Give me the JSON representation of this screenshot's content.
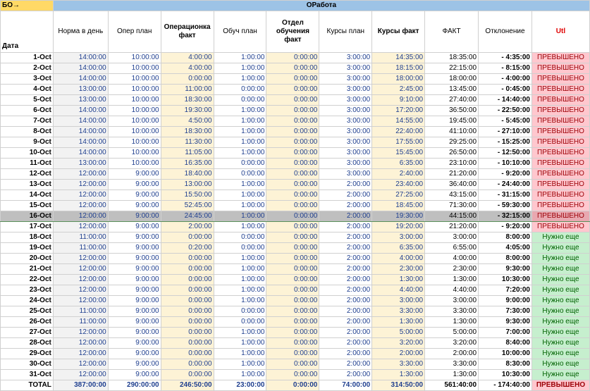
{
  "top": {
    "corner": "БО→",
    "group": "ОРабота"
  },
  "headers": {
    "date": "Дата",
    "norm": "Норма в день",
    "oper_plan": "Опер план",
    "oper_fact": "Операционка факт",
    "train_plan": "Обуч план",
    "train_dept_fact": "Отдел обучения факт",
    "course_plan": "Курсы план",
    "course_fact": "Курсы факт",
    "fact": "ФАКТ",
    "deviation": "Отклонение",
    "util": "Utl"
  },
  "rows": [
    {
      "date": "1-Oct",
      "norm": "14:00:00",
      "oper_plan": "10:00:00",
      "oper_fact": "4:00:00",
      "train_plan": "1:00:00",
      "dept": "0:00:00",
      "course_plan": "3:00:00",
      "course_fact": "14:35:00",
      "fact": "18:35:00",
      "dev": "- 4:35:00",
      "status": "ПРЕВЫШЕНО"
    },
    {
      "date": "2-Oct",
      "norm": "14:00:00",
      "oper_plan": "10:00:00",
      "oper_fact": "4:00:00",
      "train_plan": "1:00:00",
      "dept": "0:00:00",
      "course_plan": "3:00:00",
      "course_fact": "18:15:00",
      "fact": "22:15:00",
      "dev": "- 8:15:00",
      "status": "ПРЕВЫШЕНО"
    },
    {
      "date": "3-Oct",
      "norm": "14:00:00",
      "oper_plan": "10:00:00",
      "oper_fact": "0:00:00",
      "train_plan": "1:00:00",
      "dept": "0:00:00",
      "course_plan": "3:00:00",
      "course_fact": "18:00:00",
      "fact": "18:00:00",
      "dev": "- 4:00:00",
      "status": "ПРЕВЫШЕНО"
    },
    {
      "date": "4-Oct",
      "norm": "13:00:00",
      "oper_plan": "10:00:00",
      "oper_fact": "11:00:00",
      "train_plan": "0:00:00",
      "dept": "0:00:00",
      "course_plan": "3:00:00",
      "course_fact": "2:45:00",
      "fact": "13:45:00",
      "dev": "- 0:45:00",
      "status": "ПРЕВЫШЕНО"
    },
    {
      "date": "5-Oct",
      "norm": "13:00:00",
      "oper_plan": "10:00:00",
      "oper_fact": "18:30:00",
      "train_plan": "0:00:00",
      "dept": "0:00:00",
      "course_plan": "3:00:00",
      "course_fact": "9:10:00",
      "fact": "27:40:00",
      "dev": "- 14:40:00",
      "status": "ПРЕВЫШЕНО"
    },
    {
      "date": "6-Oct",
      "norm": "14:00:00",
      "oper_plan": "10:00:00",
      "oper_fact": "19:30:00",
      "train_plan": "1:00:00",
      "dept": "0:00:00",
      "course_plan": "3:00:00",
      "course_fact": "17:20:00",
      "fact": "36:50:00",
      "dev": "- 22:50:00",
      "status": "ПРЕВЫШЕНО"
    },
    {
      "date": "7-Oct",
      "norm": "14:00:00",
      "oper_plan": "10:00:00",
      "oper_fact": "4:50:00",
      "train_plan": "1:00:00",
      "dept": "0:00:00",
      "course_plan": "3:00:00",
      "course_fact": "14:55:00",
      "fact": "19:45:00",
      "dev": "- 5:45:00",
      "status": "ПРЕВЫШЕНО"
    },
    {
      "date": "8-Oct",
      "norm": "14:00:00",
      "oper_plan": "10:00:00",
      "oper_fact": "18:30:00",
      "train_plan": "1:00:00",
      "dept": "0:00:00",
      "course_plan": "3:00:00",
      "course_fact": "22:40:00",
      "fact": "41:10:00",
      "dev": "- 27:10:00",
      "status": "ПРЕВЫШЕНО"
    },
    {
      "date": "9-Oct",
      "norm": "14:00:00",
      "oper_plan": "10:00:00",
      "oper_fact": "11:30:00",
      "train_plan": "1:00:00",
      "dept": "0:00:00",
      "course_plan": "3:00:00",
      "course_fact": "17:55:00",
      "fact": "29:25:00",
      "dev": "- 15:25:00",
      "status": "ПРЕВЫШЕНО"
    },
    {
      "date": "10-Oct",
      "norm": "14:00:00",
      "oper_plan": "10:00:00",
      "oper_fact": "11:05:00",
      "train_plan": "1:00:00",
      "dept": "0:00:00",
      "course_plan": "3:00:00",
      "course_fact": "15:45:00",
      "fact": "26:50:00",
      "dev": "- 12:50:00",
      "status": "ПРЕВЫШЕНО"
    },
    {
      "date": "11-Oct",
      "norm": "13:00:00",
      "oper_plan": "10:00:00",
      "oper_fact": "16:35:00",
      "train_plan": "0:00:00",
      "dept": "0:00:00",
      "course_plan": "3:00:00",
      "course_fact": "6:35:00",
      "fact": "23:10:00",
      "dev": "- 10:10:00",
      "status": "ПРЕВЫШЕНО"
    },
    {
      "date": "12-Oct",
      "norm": "12:00:00",
      "oper_plan": "9:00:00",
      "oper_fact": "18:40:00",
      "train_plan": "0:00:00",
      "dept": "0:00:00",
      "course_plan": "3:00:00",
      "course_fact": "2:40:00",
      "fact": "21:20:00",
      "dev": "- 9:20:00",
      "status": "ПРЕВЫШЕНО"
    },
    {
      "date": "13-Oct",
      "norm": "12:00:00",
      "oper_plan": "9:00:00",
      "oper_fact": "13:00:00",
      "train_plan": "1:00:00",
      "dept": "0:00:00",
      "course_plan": "2:00:00",
      "course_fact": "23:40:00",
      "fact": "36:40:00",
      "dev": "- 24:40:00",
      "status": "ПРЕВЫШЕНО"
    },
    {
      "date": "14-Oct",
      "norm": "12:00:00",
      "oper_plan": "9:00:00",
      "oper_fact": "15:50:00",
      "train_plan": "1:00:00",
      "dept": "0:00:00",
      "course_plan": "2:00:00",
      "course_fact": "27:25:00",
      "fact": "43:15:00",
      "dev": "- 31:15:00",
      "status": "ПРЕВЫШЕНО"
    },
    {
      "date": "15-Oct",
      "norm": "12:00:00",
      "oper_plan": "9:00:00",
      "oper_fact": "52:45:00",
      "train_plan": "1:00:00",
      "dept": "0:00:00",
      "course_plan": "2:00:00",
      "course_fact": "18:45:00",
      "fact": "71:30:00",
      "dev": "- 59:30:00",
      "status": "ПРЕВЫШЕНО"
    },
    {
      "date": "16-Oct",
      "norm": "12:00:00",
      "oper_plan": "9:00:00",
      "oper_fact": "24:45:00",
      "train_plan": "1:00:00",
      "dept": "0:00:00",
      "course_plan": "2:00:00",
      "course_fact": "19:30:00",
      "fact": "44:15:00",
      "dev": "- 32:15:00",
      "status": "ПРЕВЫШЕНО"
    },
    {
      "date": "17-Oct",
      "norm": "12:00:00",
      "oper_plan": "9:00:00",
      "oper_fact": "2:00:00",
      "train_plan": "1:00:00",
      "dept": "0:00:00",
      "course_plan": "2:00:00",
      "course_fact": "19:20:00",
      "fact": "21:20:00",
      "dev": "- 9:20:00",
      "status": "ПРЕВЫШЕНО"
    },
    {
      "date": "18-Oct",
      "norm": "11:00:00",
      "oper_plan": "9:00:00",
      "oper_fact": "0:00:00",
      "train_plan": "0:00:00",
      "dept": "0:00:00",
      "course_plan": "2:00:00",
      "course_fact": "3:00:00",
      "fact": "3:00:00",
      "dev": "8:00:00",
      "status": "Нужно еще"
    },
    {
      "date": "19-Oct",
      "norm": "11:00:00",
      "oper_plan": "9:00:00",
      "oper_fact": "0:20:00",
      "train_plan": "0:00:00",
      "dept": "0:00:00",
      "course_plan": "2:00:00",
      "course_fact": "6:35:00",
      "fact": "6:55:00",
      "dev": "4:05:00",
      "status": "Нужно еще"
    },
    {
      "date": "20-Oct",
      "norm": "12:00:00",
      "oper_plan": "9:00:00",
      "oper_fact": "0:00:00",
      "train_plan": "1:00:00",
      "dept": "0:00:00",
      "course_plan": "2:00:00",
      "course_fact": "4:00:00",
      "fact": "4:00:00",
      "dev": "8:00:00",
      "status": "Нужно еще"
    },
    {
      "date": "21-Oct",
      "norm": "12:00:00",
      "oper_plan": "9:00:00",
      "oper_fact": "0:00:00",
      "train_plan": "1:00:00",
      "dept": "0:00:00",
      "course_plan": "2:00:00",
      "course_fact": "2:30:00",
      "fact": "2:30:00",
      "dev": "9:30:00",
      "status": "Нужно еще"
    },
    {
      "date": "22-Oct",
      "norm": "12:00:00",
      "oper_plan": "9:00:00",
      "oper_fact": "0:00:00",
      "train_plan": "1:00:00",
      "dept": "0:00:00",
      "course_plan": "2:00:00",
      "course_fact": "1:30:00",
      "fact": "1:30:00",
      "dev": "10:30:00",
      "status": "Нужно еще"
    },
    {
      "date": "23-Oct",
      "norm": "12:00:00",
      "oper_plan": "9:00:00",
      "oper_fact": "0:00:00",
      "train_plan": "1:00:00",
      "dept": "0:00:00",
      "course_plan": "2:00:00",
      "course_fact": "4:40:00",
      "fact": "4:40:00",
      "dev": "7:20:00",
      "status": "Нужно еще"
    },
    {
      "date": "24-Oct",
      "norm": "12:00:00",
      "oper_plan": "9:00:00",
      "oper_fact": "0:00:00",
      "train_plan": "1:00:00",
      "dept": "0:00:00",
      "course_plan": "2:00:00",
      "course_fact": "3:00:00",
      "fact": "3:00:00",
      "dev": "9:00:00",
      "status": "Нужно еще"
    },
    {
      "date": "25-Oct",
      "norm": "11:00:00",
      "oper_plan": "9:00:00",
      "oper_fact": "0:00:00",
      "train_plan": "0:00:00",
      "dept": "0:00:00",
      "course_plan": "2:00:00",
      "course_fact": "3:30:00",
      "fact": "3:30:00",
      "dev": "7:30:00",
      "status": "Нужно еще"
    },
    {
      "date": "26-Oct",
      "norm": "11:00:00",
      "oper_plan": "9:00:00",
      "oper_fact": "0:00:00",
      "train_plan": "0:00:00",
      "dept": "0:00:00",
      "course_plan": "2:00:00",
      "course_fact": "1:30:00",
      "fact": "1:30:00",
      "dev": "9:30:00",
      "status": "Нужно еще"
    },
    {
      "date": "27-Oct",
      "norm": "12:00:00",
      "oper_plan": "9:00:00",
      "oper_fact": "0:00:00",
      "train_plan": "1:00:00",
      "dept": "0:00:00",
      "course_plan": "2:00:00",
      "course_fact": "5:00:00",
      "fact": "5:00:00",
      "dev": "7:00:00",
      "status": "Нужно еще"
    },
    {
      "date": "28-Oct",
      "norm": "12:00:00",
      "oper_plan": "9:00:00",
      "oper_fact": "0:00:00",
      "train_plan": "1:00:00",
      "dept": "0:00:00",
      "course_plan": "2:00:00",
      "course_fact": "3:20:00",
      "fact": "3:20:00",
      "dev": "8:40:00",
      "status": "Нужно еще"
    },
    {
      "date": "29-Oct",
      "norm": "12:00:00",
      "oper_plan": "9:00:00",
      "oper_fact": "0:00:00",
      "train_plan": "1:00:00",
      "dept": "0:00:00",
      "course_plan": "2:00:00",
      "course_fact": "2:00:00",
      "fact": "2:00:00",
      "dev": "10:00:00",
      "status": "Нужно еще"
    },
    {
      "date": "30-Oct",
      "norm": "12:00:00",
      "oper_plan": "9:00:00",
      "oper_fact": "0:00:00",
      "train_plan": "1:00:00",
      "dept": "0:00:00",
      "course_plan": "2:00:00",
      "course_fact": "3:30:00",
      "fact": "3:30:00",
      "dev": "8:30:00",
      "status": "Нужно еще"
    },
    {
      "date": "31-Oct",
      "norm": "12:00:00",
      "oper_plan": "9:00:00",
      "oper_fact": "0:00:00",
      "train_plan": "1:00:00",
      "dept": "0:00:00",
      "course_plan": "2:00:00",
      "course_fact": "1:30:00",
      "fact": "1:30:00",
      "dev": "10:30:00",
      "status": "Нужно еще"
    }
  ],
  "total": {
    "date": "TOTAL",
    "norm": "387:00:00",
    "oper_plan": "290:00:00",
    "oper_fact": "246:50:00",
    "train_plan": "23:00:00",
    "dept": "0:00:00",
    "course_plan": "74:00:00",
    "course_fact": "314:50:00",
    "fact": "561:40:00",
    "dev": "- 174:40:00",
    "status": "ПРЕВЫШЕНО"
  },
  "selected_row_index": 15,
  "colors": {
    "exceeded_fill": "#ffc7ce",
    "exceeded_text": "#9c0006",
    "need_fill": "#c6efce",
    "need_text": "#006100",
    "header_group": "#9dc3e6",
    "corner": "#ffd966"
  }
}
